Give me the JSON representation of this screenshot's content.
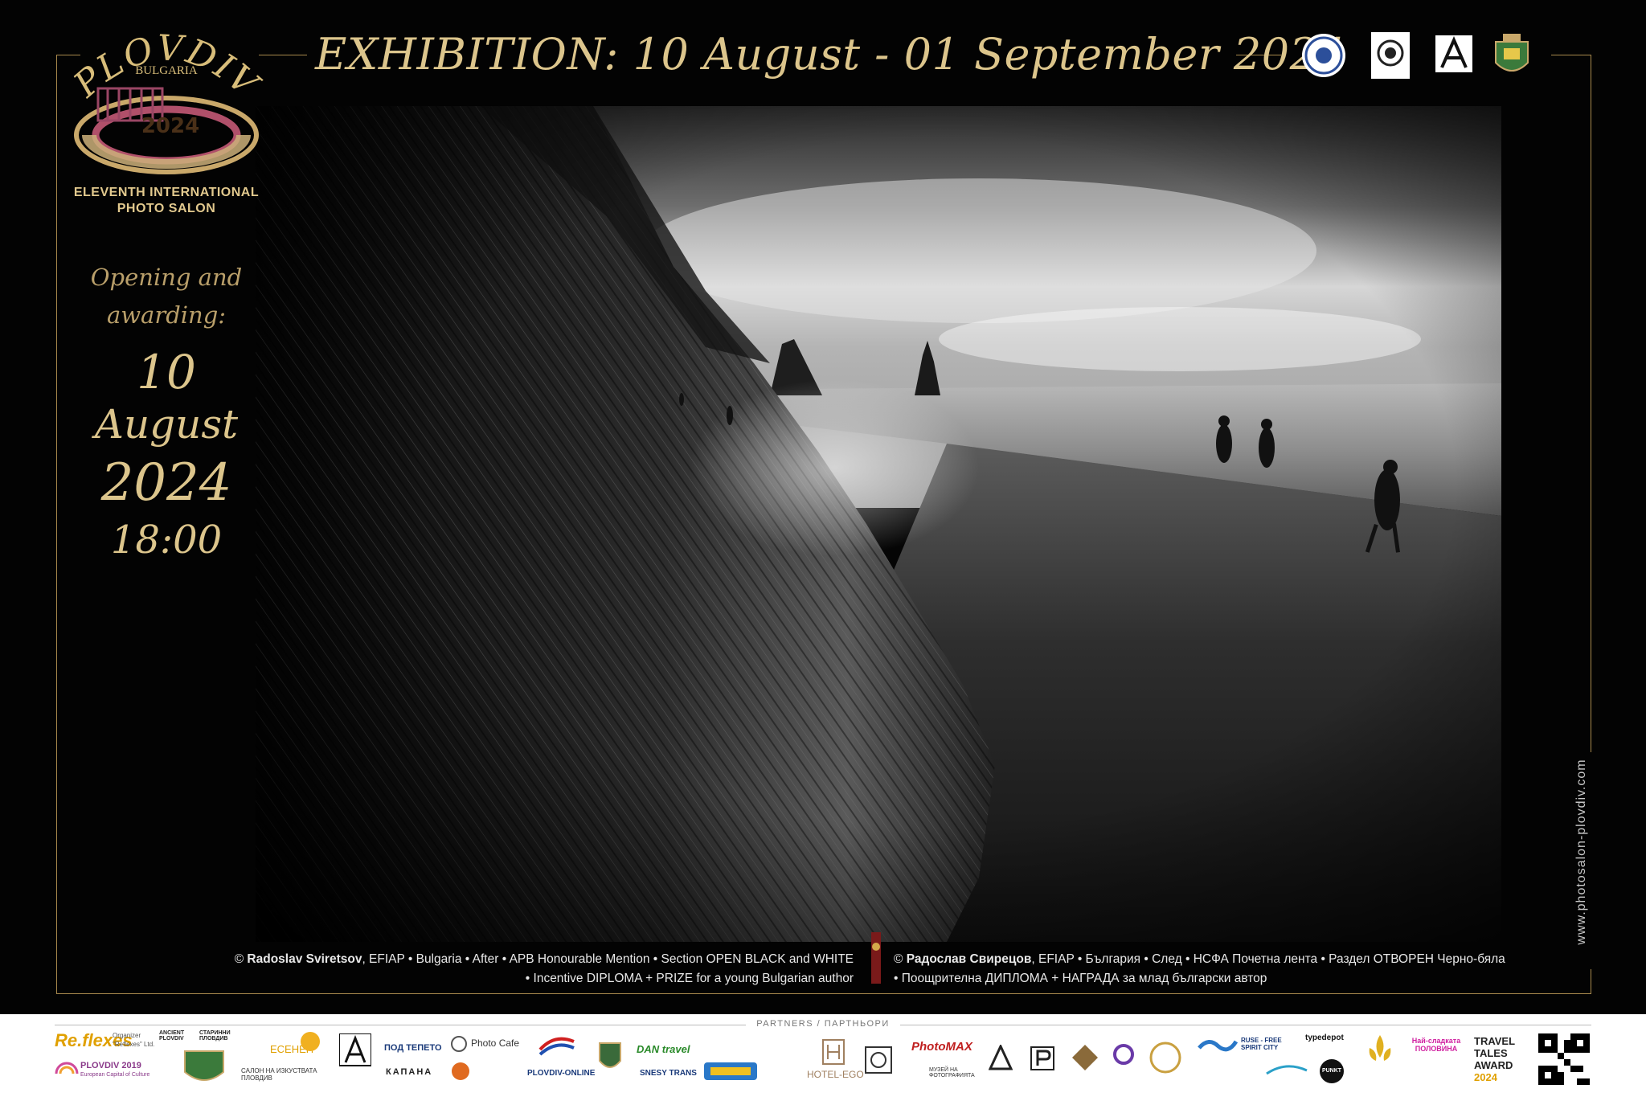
{
  "header": {
    "exhibition": "EXHIBITION:  10 August - 01 September 2024"
  },
  "logo": {
    "city": "PLOVDIV",
    "country": "BULGARIA",
    "year": "2024",
    "salon_line1": "ELEVENTH INTERNATIONAL",
    "salon_line2": "PHOTO SALON"
  },
  "opening": {
    "label_line1": "Opening and",
    "label_line2": "awarding:",
    "day": "10",
    "month": "August",
    "year": "2024",
    "time": "18:00"
  },
  "credit_en": {
    "author": "Radoslav Sviretsov",
    "line1_rest": ", EFIAP • Bulgaria • After • APB Honourable Mention • Section OPEN BLACK and WHITE",
    "line2": "• Incentive DIPLOMA + PRIZE for a young Bulgarian author"
  },
  "credit_bg": {
    "author": "Радослав Свирецов",
    "line1_rest": ", EFIAP • България • След • НСФА Почетна лента • Раздел ОТВОРЕН Черно-бяла",
    "line2": "• Поощрителна ДИПЛОМА + НАГРАДА за млад български автор"
  },
  "copyright_symbol": "©",
  "website": "www.photosalon-plovdiv.com",
  "partners": {
    "label": "PARTNERS / ПАРТНЬОРИ",
    "items": {
      "reflexes": "Re.flexes",
      "organizer": "Organizer",
      "organizer_sub": "\"Reflexes\" Ltd.",
      "ancient_plovdiv": "ANCIENT PLOVDIV",
      "stinni": "СТАРИННИ ПЛОВДИВ",
      "plovdiv2019": "PLOVDIV 2019",
      "plovdiv2019_sub": "European Capital of Culture",
      "esenen": "ЕСЕНЕН",
      "esenen_sub": "САЛОН НА ИЗКУСТВАТА ПЛОВДИВ",
      "pod_tepeto": "ПОД ТЕПЕТО",
      "kapana": "КАПАНА",
      "photo_cafe": "Photo Cafe",
      "plovdiv_online": "PLOVDIV-ONLINE",
      "dan_travel": "DAN travel",
      "snesy": "SNESY TRANS",
      "hotel_ego": "HOTEL-EGO",
      "photomax": "PhotoMAX",
      "muzei": "МУЗЕЙ НА ФОТОГРАФИЯТА",
      "ruse": "RUSE - FREE SPIRIT CITY",
      "typedepot": "typedepot",
      "punkt": "PUNKT",
      "naisladkata": "Най-сладката ПОЛОВИНА",
      "travel": "TRAVEL",
      "tales": "TALES",
      "award": "AWARD",
      "award_year": "2024"
    }
  },
  "colors": {
    "gold": "#dcc58c",
    "gold_dim": "#b99f6a",
    "frame": "#a8894d",
    "background": "#030303"
  }
}
